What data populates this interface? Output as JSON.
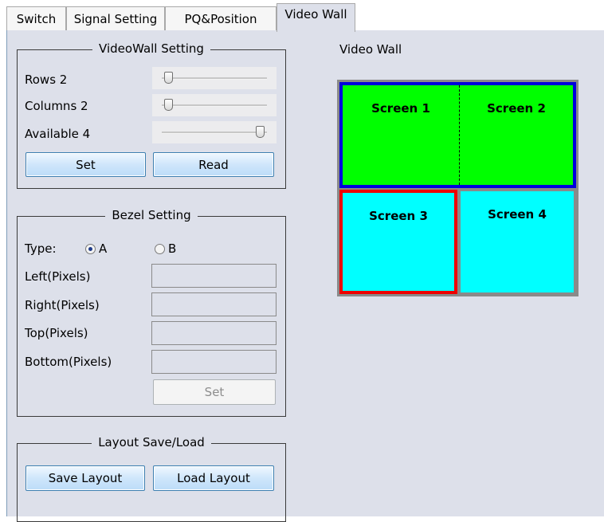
{
  "tabs": [
    {
      "label": "Switch",
      "active": false
    },
    {
      "label": "Signal Setting",
      "active": false
    },
    {
      "label": "PQ&Position",
      "active": false
    },
    {
      "label": "Video Wall",
      "active": true
    }
  ],
  "videowall_setting": {
    "title": "VideoWall Setting",
    "rows_label": "Rows 2",
    "rows_value": 2,
    "columns_label": "Columns 2",
    "columns_value": 2,
    "available_label": "Available 4",
    "available_value": 4,
    "set_label": "Set",
    "read_label": "Read"
  },
  "bezel_setting": {
    "title": "Bezel Setting",
    "type_label": "Type:",
    "option_a": "A",
    "option_b": "B",
    "selected": "A",
    "left_label": "Left(Pixels)",
    "right_label": "Right(Pixels)",
    "top_label": "Top(Pixels)",
    "bottom_label": "Bottom(Pixels)",
    "left_value": "",
    "right_value": "",
    "top_value": "",
    "bottom_value": "",
    "set_label": "Set"
  },
  "layout": {
    "title": "Layout Save/Load",
    "save_label": "Save Layout",
    "load_label": "Load Layout"
  },
  "video_wall": {
    "title": "Video Wall",
    "screens": [
      {
        "label": "Screen 1",
        "color": "#00ff00"
      },
      {
        "label": "Screen 2",
        "color": "#00ff00"
      },
      {
        "label": "Screen 3",
        "color": "#00ffff"
      },
      {
        "label": "Screen 4",
        "color": "#00ffff"
      }
    ],
    "merged_border_color": "#0000dd",
    "selected_border_color": "#ee0000"
  }
}
